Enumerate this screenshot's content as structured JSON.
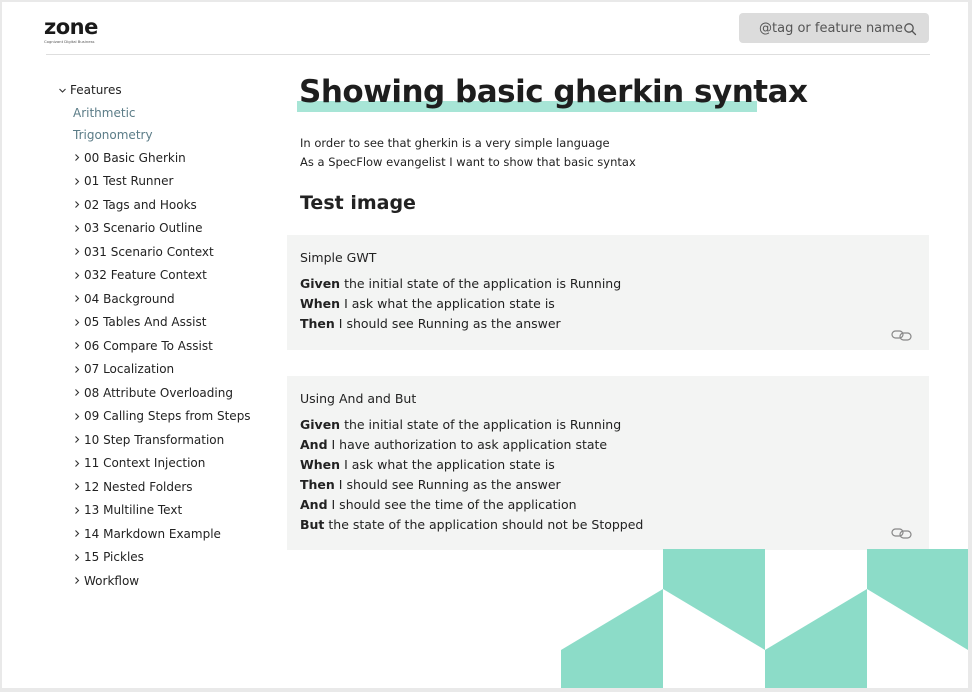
{
  "logo": {
    "word": "zone",
    "subtitle": "Cognizant Digital Business"
  },
  "search": {
    "placeholder": "@tag or feature name"
  },
  "sidebar": {
    "root": "Features",
    "links": [
      "Arithmetic",
      "Trigonometry"
    ],
    "folders": [
      "00 Basic Gherkin",
      "01 Test Runner",
      "02 Tags and Hooks",
      "03 Scenario Outline",
      "031 Scenario Context",
      "032 Feature Context",
      "04 Background",
      "05 Tables And Assist",
      "06 Compare To Assist",
      "07 Localization",
      "08 Attribute Overloading",
      "09 Calling Steps from Steps",
      "10 Step Transformation",
      "11 Context Injection",
      "12 Nested Folders",
      "13 Multiline Text",
      "14 Markdown Example",
      "15 Pickles",
      "Workflow"
    ]
  },
  "main": {
    "title": "Showing basic gherkin syntax",
    "description": [
      "In order to see that gherkin is a very simple language",
      "As a SpecFlow evangelist I want to show that basic syntax"
    ],
    "section_title": "Test image",
    "scenarios": [
      {
        "title": "Simple GWT",
        "steps": [
          {
            "keyword": "Given",
            "text": "the initial state of the application is Running"
          },
          {
            "keyword": "When",
            "text": "I ask what the application state is"
          },
          {
            "keyword": "Then",
            "text": "I should see Running as the answer"
          }
        ]
      },
      {
        "title": "Using And and But",
        "steps": [
          {
            "keyword": "Given",
            "text": "the initial state of the application is Running"
          },
          {
            "keyword": "And",
            "text": "I have authorization to ask application state"
          },
          {
            "keyword": "When",
            "text": "I ask what the application state is"
          },
          {
            "keyword": "Then",
            "text": "I should see Running as the answer"
          },
          {
            "keyword": "And",
            "text": "I should see the time of the application"
          },
          {
            "keyword": "But",
            "text": "the state of the application should not be Stopped"
          }
        ]
      }
    ]
  },
  "colors": {
    "accent": "#8cdcc8",
    "title_highlight": "#a7e5d6",
    "link": "#5b7c87",
    "scenario_bg": "#f3f4f3"
  },
  "icons": {
    "search": "search-icon",
    "chevron": "chevron-right-icon",
    "chevron_open": "chevron-down-icon",
    "permalink": "link-icon"
  }
}
